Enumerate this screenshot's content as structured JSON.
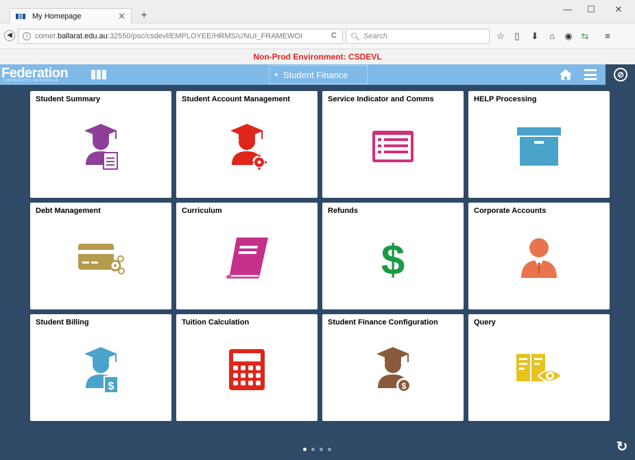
{
  "browser": {
    "tab_title": "My Homepage",
    "url_scheme_path_before": "comet.",
    "url_host": "ballarat.edu.au",
    "url_rest": ":32550/psc/csdevl/EMPLOYEE/HRMS/c/NUI_FRAMEWOI",
    "search_placeholder": "Search"
  },
  "environment_banner": "Non-Prod Environment: CSDEVL",
  "header": {
    "logo_text": "Federation",
    "logo_subtext": "UNIVERSITY·AUSTRALIA",
    "homepage_selector": "Student Finance"
  },
  "tiles": [
    {
      "title": "Student Summary",
      "icon": "student-summary-icon",
      "color": "#8e3f9a"
    },
    {
      "title": "Student Account Management",
      "icon": "student-account-icon",
      "color": "#e0251b"
    },
    {
      "title": "Service Indicator and Comms",
      "icon": "list-card-icon",
      "color": "#d1307b"
    },
    {
      "title": "HELP Processing",
      "icon": "archive-box-icon",
      "color": "#4aa3c9"
    },
    {
      "title": "Debt Management",
      "icon": "credit-card-gear-icon",
      "color": "#b59b4e"
    },
    {
      "title": "Curriculum",
      "icon": "book-icon",
      "color": "#c4308a"
    },
    {
      "title": "Refunds",
      "icon": "dollar-icon",
      "color": "#1a9a44"
    },
    {
      "title": "Corporate Accounts",
      "icon": "business-person-icon",
      "color": "#e8744e"
    },
    {
      "title": "Student Billing",
      "icon": "student-billing-icon",
      "color": "#4aa3c9"
    },
    {
      "title": "Tuition Calculation",
      "icon": "calculator-icon",
      "color": "#e0251b"
    },
    {
      "title": "Student Finance Configuration",
      "icon": "student-config-icon",
      "color": "#8a5a3c"
    },
    {
      "title": "Query",
      "icon": "query-view-icon",
      "color": "#e8c21e"
    }
  ],
  "pager": {
    "pages": 4,
    "current": 1
  }
}
